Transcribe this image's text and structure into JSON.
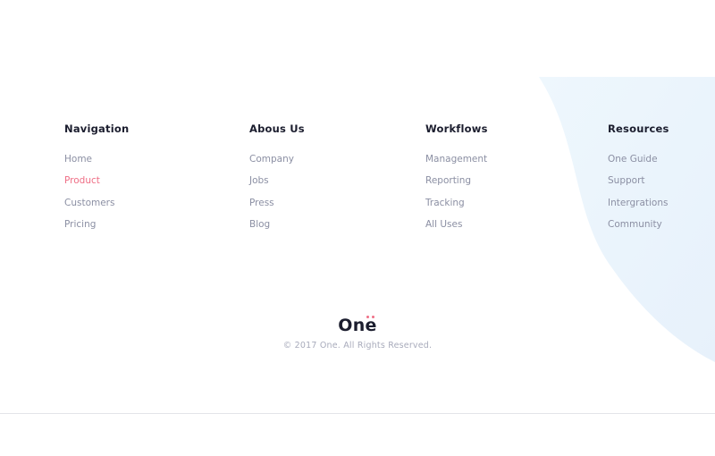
{
  "footer": {
    "accent_color": "#ef6f86",
    "shape_color": "#eaf4fc",
    "columns": [
      {
        "heading": "Navigation",
        "links": [
          "Home",
          "Product",
          "Customers",
          "Pricing"
        ],
        "active_index": 1
      },
      {
        "heading": "Abous Us",
        "links": [
          "Company",
          "Jobs",
          "Press",
          "Blog"
        ]
      },
      {
        "heading": "Workflows",
        "links": [
          "Management",
          "Reporting",
          "Tracking",
          "All Uses"
        ]
      },
      {
        "heading": "Resources",
        "links": [
          "One Guide",
          "Support",
          "Intergrations",
          "Community"
        ]
      }
    ],
    "logo_text": "One",
    "copyright": "© 2017 One. All Rights Reserved."
  }
}
